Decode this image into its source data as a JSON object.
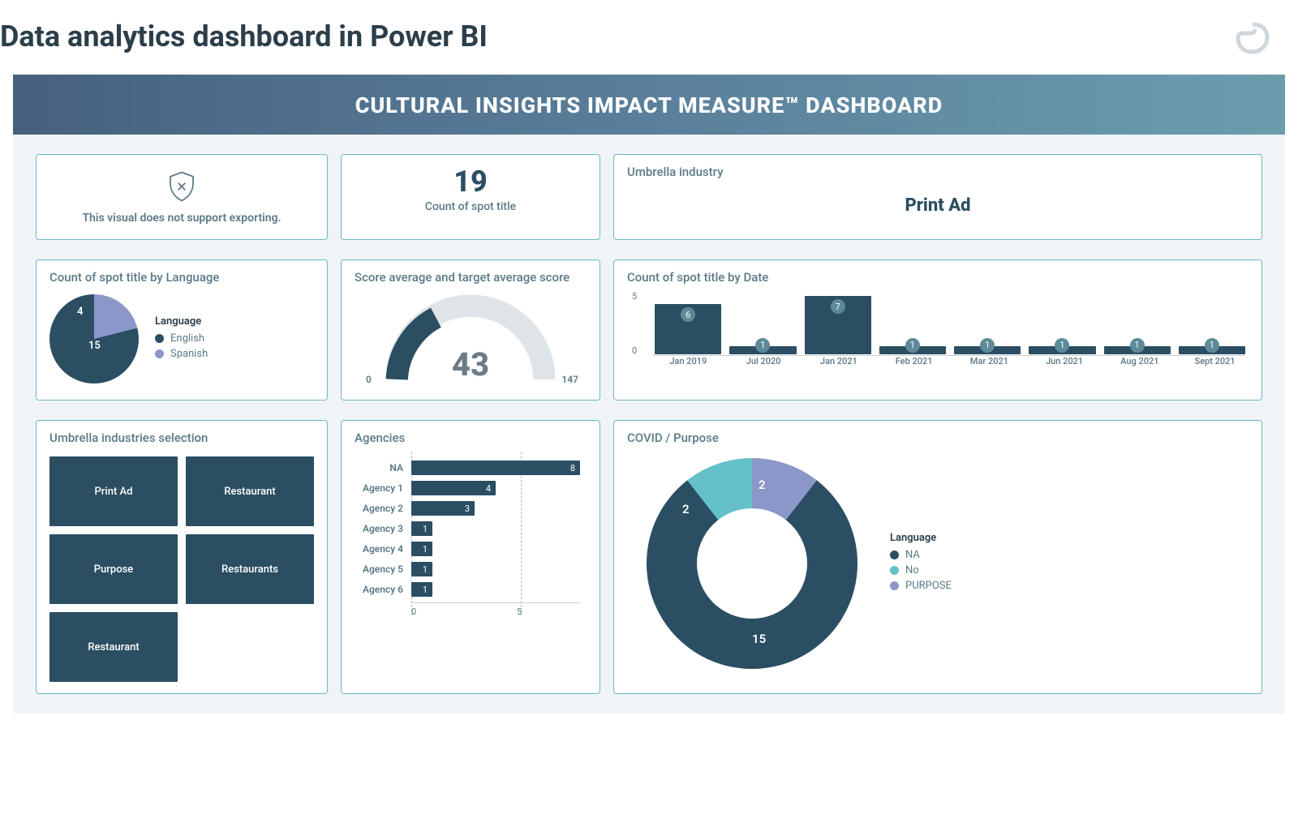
{
  "page": {
    "title": "Data analytics dashboard in Power BI"
  },
  "dashboard": {
    "title": "CULTURAL INSIGHTS IMPACT MEASURE™ DASHBOARD"
  },
  "kpi": {
    "export_error": "This visual does not support exporting.",
    "count_value": "19",
    "count_label": "Count of spot title",
    "umbrella_title": "Umbrella industry",
    "umbrella_value": "Print Ad"
  },
  "pie": {
    "title": "Count of spot title by Language",
    "legend_title": "Language",
    "legend": [
      {
        "label": "English",
        "color": "#2b4e62"
      },
      {
        "label": "Spanish",
        "color": "#8c97c9"
      }
    ]
  },
  "gauge": {
    "title": "Score average and target average score",
    "value": "43",
    "min": "0",
    "max": "147"
  },
  "columns": {
    "title": "Count of spot title by Date",
    "y_top": "5",
    "y_bot": "0"
  },
  "treemap": {
    "title": "Umbrella industries selection",
    "tiles": [
      "Print Ad",
      "Restaurant",
      "Purpose",
      "Restaurants",
      "Restaurant"
    ]
  },
  "agencies": {
    "title": "Agencies",
    "axis0": "0",
    "axis5": "5"
  },
  "donut": {
    "title": "COVID / Purpose",
    "legend_title": "Language",
    "legend": [
      {
        "label": "NA",
        "color": "#2b4e62"
      },
      {
        "label": "No",
        "color": "#65c1c9"
      },
      {
        "label": "PURPOSE",
        "color": "#8c97c9"
      }
    ]
  },
  "chart_data": [
    {
      "id": "count_by_language_pie",
      "type": "pie",
      "title": "Count of spot title by Language",
      "categories": [
        "English",
        "Spanish"
      ],
      "values": [
        15,
        4
      ]
    },
    {
      "id": "score_gauge",
      "type": "gauge",
      "title": "Score average and target average score",
      "value": 43,
      "min": 0,
      "max": 147
    },
    {
      "id": "count_by_date_bar",
      "type": "bar",
      "title": "Count of spot title by Date",
      "categories": [
        "Jan 2019",
        "Jul 2020",
        "Jan 2021",
        "Feb 2021",
        "Mar 2021",
        "Jun 2021",
        "Aug 2021",
        "Sept 2021"
      ],
      "values": [
        6,
        1,
        7,
        1,
        1,
        1,
        1,
        1
      ],
      "ylim": [
        0,
        7
      ]
    },
    {
      "id": "umbrella_treemap",
      "type": "treemap",
      "title": "Umbrella industries selection",
      "categories": [
        "Print Ad",
        "Restaurant",
        "Purpose",
        "Restaurants",
        "Restaurant"
      ]
    },
    {
      "id": "agencies_bar",
      "type": "bar",
      "orientation": "horizontal",
      "title": "Agencies",
      "categories": [
        "NA",
        "Agency 1",
        "Agency 2",
        "Agency 3",
        "Agency 4",
        "Agency 5",
        "Agency 6"
      ],
      "values": [
        8,
        4,
        3,
        1,
        1,
        1,
        1
      ],
      "xlim": [
        0,
        8
      ]
    },
    {
      "id": "covid_purpose_donut",
      "type": "pie",
      "title": "COVID / Purpose",
      "categories": [
        "NA",
        "No",
        "PURPOSE"
      ],
      "values": [
        15,
        2,
        2
      ]
    }
  ]
}
